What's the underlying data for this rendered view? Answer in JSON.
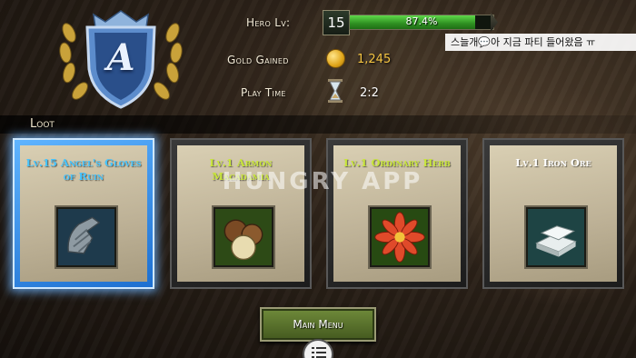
{
  "stats": {
    "hero_level_label": "Hero Lv:",
    "hero_level": "15",
    "xp_percent_text": "87.4%",
    "xp_fraction": 0.874,
    "gold_label": "Gold Gained",
    "gold_value": "1,245",
    "playtime_label": "Play Time",
    "playtime_value": "2:2"
  },
  "rank": {
    "letter": "A"
  },
  "chat": {
    "text": "스늘개💬아 지금 파티 들어왔음 ㅠ"
  },
  "loot": {
    "title": "Loot",
    "items": [
      {
        "name": "Lv.15 Angel's Gloves of Ruin",
        "name_color": "#46c4ff",
        "icon": "gauntlet-icon",
        "selected": true
      },
      {
        "name": "Lv.1 Armon Macadamia",
        "name_color": "#c8e63a",
        "icon": "macadamia-icon",
        "selected": false
      },
      {
        "name": "Lv.1 Ordinary Herb",
        "name_color": "#c8e63a",
        "icon": "red-flower-icon",
        "selected": false
      },
      {
        "name": "Lv.1 Iron Ore",
        "name_color": "#ffffff",
        "icon": "iron-ingot-icon",
        "selected": false
      }
    ]
  },
  "watermark": "HUNGRY APP",
  "buttons": {
    "main_menu": "Main Menu"
  },
  "colors": {
    "gold": "#f5c542",
    "xp_green": "#3fb52d"
  }
}
